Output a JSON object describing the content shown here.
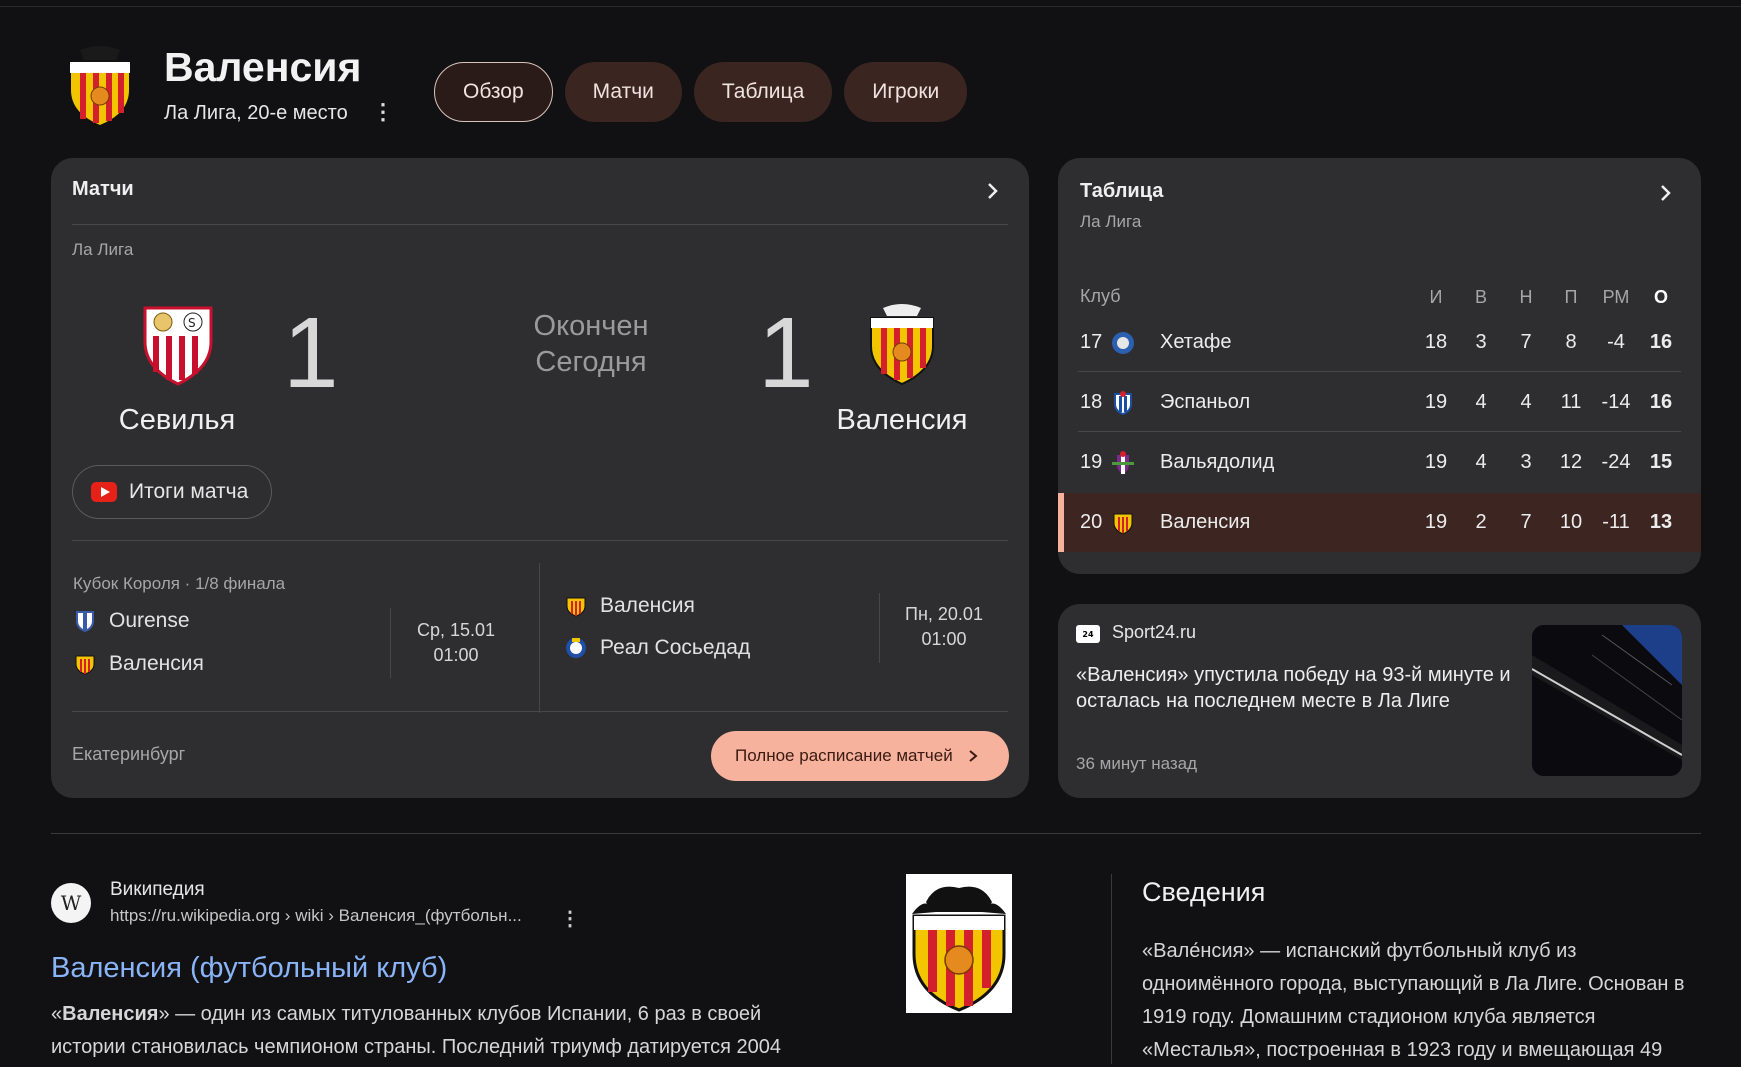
{
  "header": {
    "title": "Валенсия",
    "subtitle": "Ла Лига, 20-е место",
    "tabs": [
      {
        "label": "Обзор",
        "active": true
      },
      {
        "label": "Матчи",
        "active": false
      },
      {
        "label": "Таблица",
        "active": false
      },
      {
        "label": "Игроки",
        "active": false
      }
    ]
  },
  "matches": {
    "title": "Матчи",
    "league": "Ла Лига",
    "home": {
      "name": "Севилья",
      "score": "1"
    },
    "away": {
      "name": "Валенсия",
      "score": "1"
    },
    "status_line1": "Окончен",
    "status_line2": "Сегодня",
    "highlights_label": "Итоги матча",
    "cup_label": "Кубок Короля · 1/8 финала",
    "fixture1": {
      "team1": "Ourense",
      "team2": "Валенсия",
      "date": "Ср, 15.01",
      "time": "01:00"
    },
    "fixture2": {
      "team1": "Валенсия",
      "team2": "Реал Сосьедад",
      "date": "Пн, 20.01",
      "time": "01:00"
    },
    "city": "Екатеринбург",
    "full_schedule_label": "Полное расписание матчей"
  },
  "standings": {
    "title": "Таблица",
    "subtitle": "Ла Лига",
    "columns": [
      "Клуб",
      "И",
      "В",
      "Н",
      "П",
      "РМ",
      "О"
    ],
    "rows": [
      {
        "pos": "17",
        "club": "Хетафе",
        "p": "18",
        "w": "3",
        "d": "7",
        "l": "8",
        "gd": "-4",
        "pts": "16"
      },
      {
        "pos": "18",
        "club": "Эспаньол",
        "p": "19",
        "w": "4",
        "d": "4",
        "l": "11",
        "gd": "-14",
        "pts": "16"
      },
      {
        "pos": "19",
        "club": "Вальядолид",
        "p": "19",
        "w": "4",
        "d": "3",
        "l": "12",
        "gd": "-24",
        "pts": "15"
      },
      {
        "pos": "20",
        "club": "Валенсия",
        "p": "19",
        "w": "2",
        "d": "7",
        "l": "10",
        "gd": "-11",
        "pts": "13",
        "highlighted": true
      }
    ]
  },
  "news": {
    "source": "Sport24.ru",
    "source_logo_text": "24",
    "title": "«Валенсия» упустила победу на 93-й минуте и осталась на последнем месте в Ла Лиге",
    "time": "36 минут назад"
  },
  "wiki": {
    "site": "Википедия",
    "url": "https://ru.wikipedia.org › wiki › Валенсия_(футбольн...",
    "link": "Валенсия (футбольный клуб)",
    "snippet_bold": "Валенсия",
    "snippet_pre": "«",
    "snippet_rest": "» — один из самых титулованных клубов Испании, 6 раз в своей истории становилась чемпионом страны. Последний триумф датируется 2004"
  },
  "info": {
    "title": "Сведения",
    "text": "«Вале́нсия» — испанский футбольный клуб из одноимённого города, выступающий в Ла Лиге. Основан в 1919 году. Домашним стадионом клуба является «Месталья», построенная в 1923 году и вмещающая 49"
  },
  "colors": {
    "background": "#111113",
    "card": "#2e2e30",
    "tab": "#3a2521",
    "accent": "#f6b29c",
    "link": "#8ab4f8",
    "highlight_row": "#3d2622"
  }
}
